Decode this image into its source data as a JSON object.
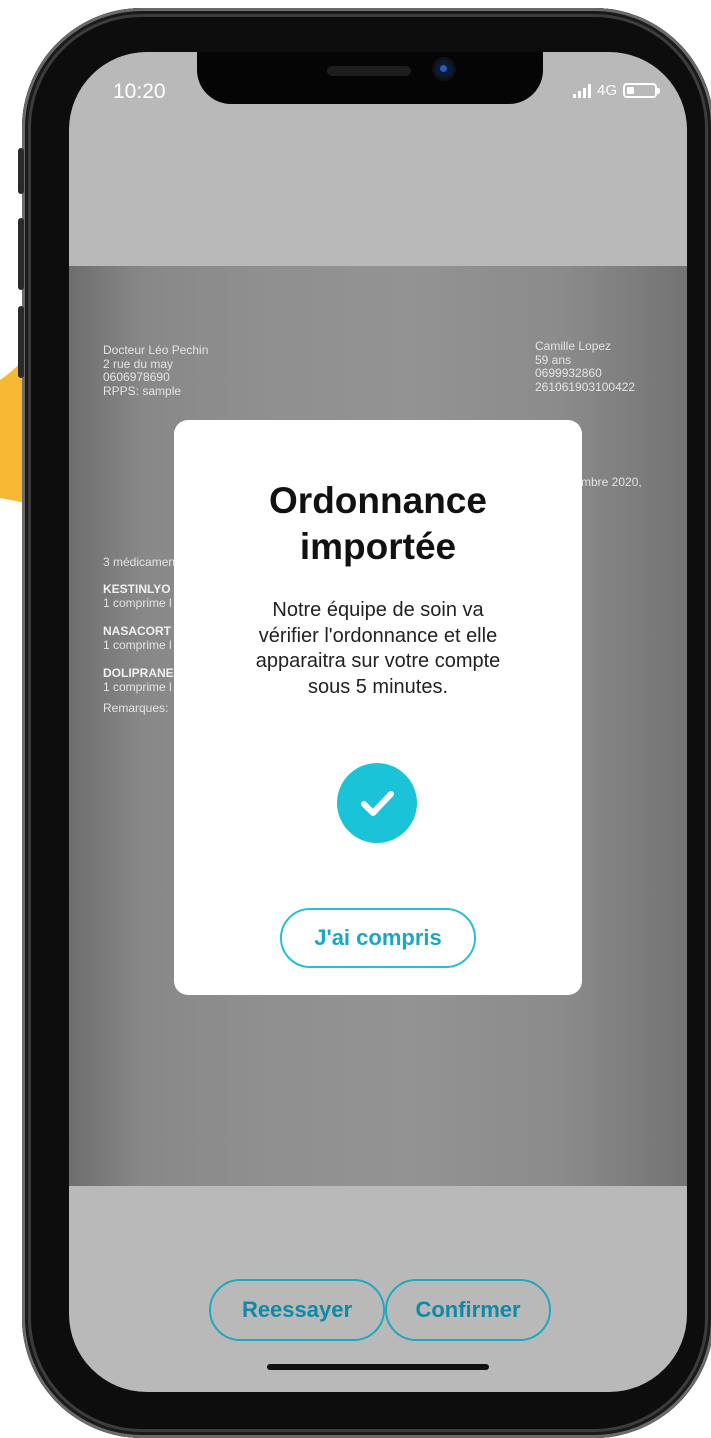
{
  "status_bar": {
    "time": "10:20",
    "network": "4G",
    "icons": [
      "signal-icon",
      "battery-icon"
    ]
  },
  "document": {
    "doctor_name": "Docteur Léo Pechin",
    "doctor_address": "2 rue du may",
    "doctor_phone": "0606978690",
    "doctor_rpps": "RPPS: sample",
    "patient_name": "Camille Lopez",
    "patient_age": "59 ans",
    "patient_phone": "0699932860",
    "patient_id": "261061903100422",
    "date_fragment": "mbre 2020,",
    "med_count": "3 médicamen",
    "med_1_name": "KESTINLYO 1",
    "med_1_dose": "1 comprime l",
    "med_2_name": "NASACORT 5",
    "med_2_dose": "1 comprime l",
    "med_3_name": "DOLIPRANE 1",
    "med_3_dose": "1 comprime l",
    "remarks": "Remarques:"
  },
  "modal": {
    "title_line1": "Ordonnance",
    "title_line2": "importée",
    "body_line1": "Notre équipe de soin va",
    "body_line2": "vérifier l'ordonnance et elle",
    "body_line3": "apparaitra sur votre compte",
    "body_line4": "sous 5 minutes.",
    "icon": "check-circle-icon",
    "button_label": "J'ai compris"
  },
  "actions": {
    "retry_label": "Reessayer",
    "confirm_label": "Confirmer"
  },
  "colors": {
    "accent": "#1bc3d9",
    "button_text": "#0e8aa6",
    "brush": "#f7b933"
  }
}
